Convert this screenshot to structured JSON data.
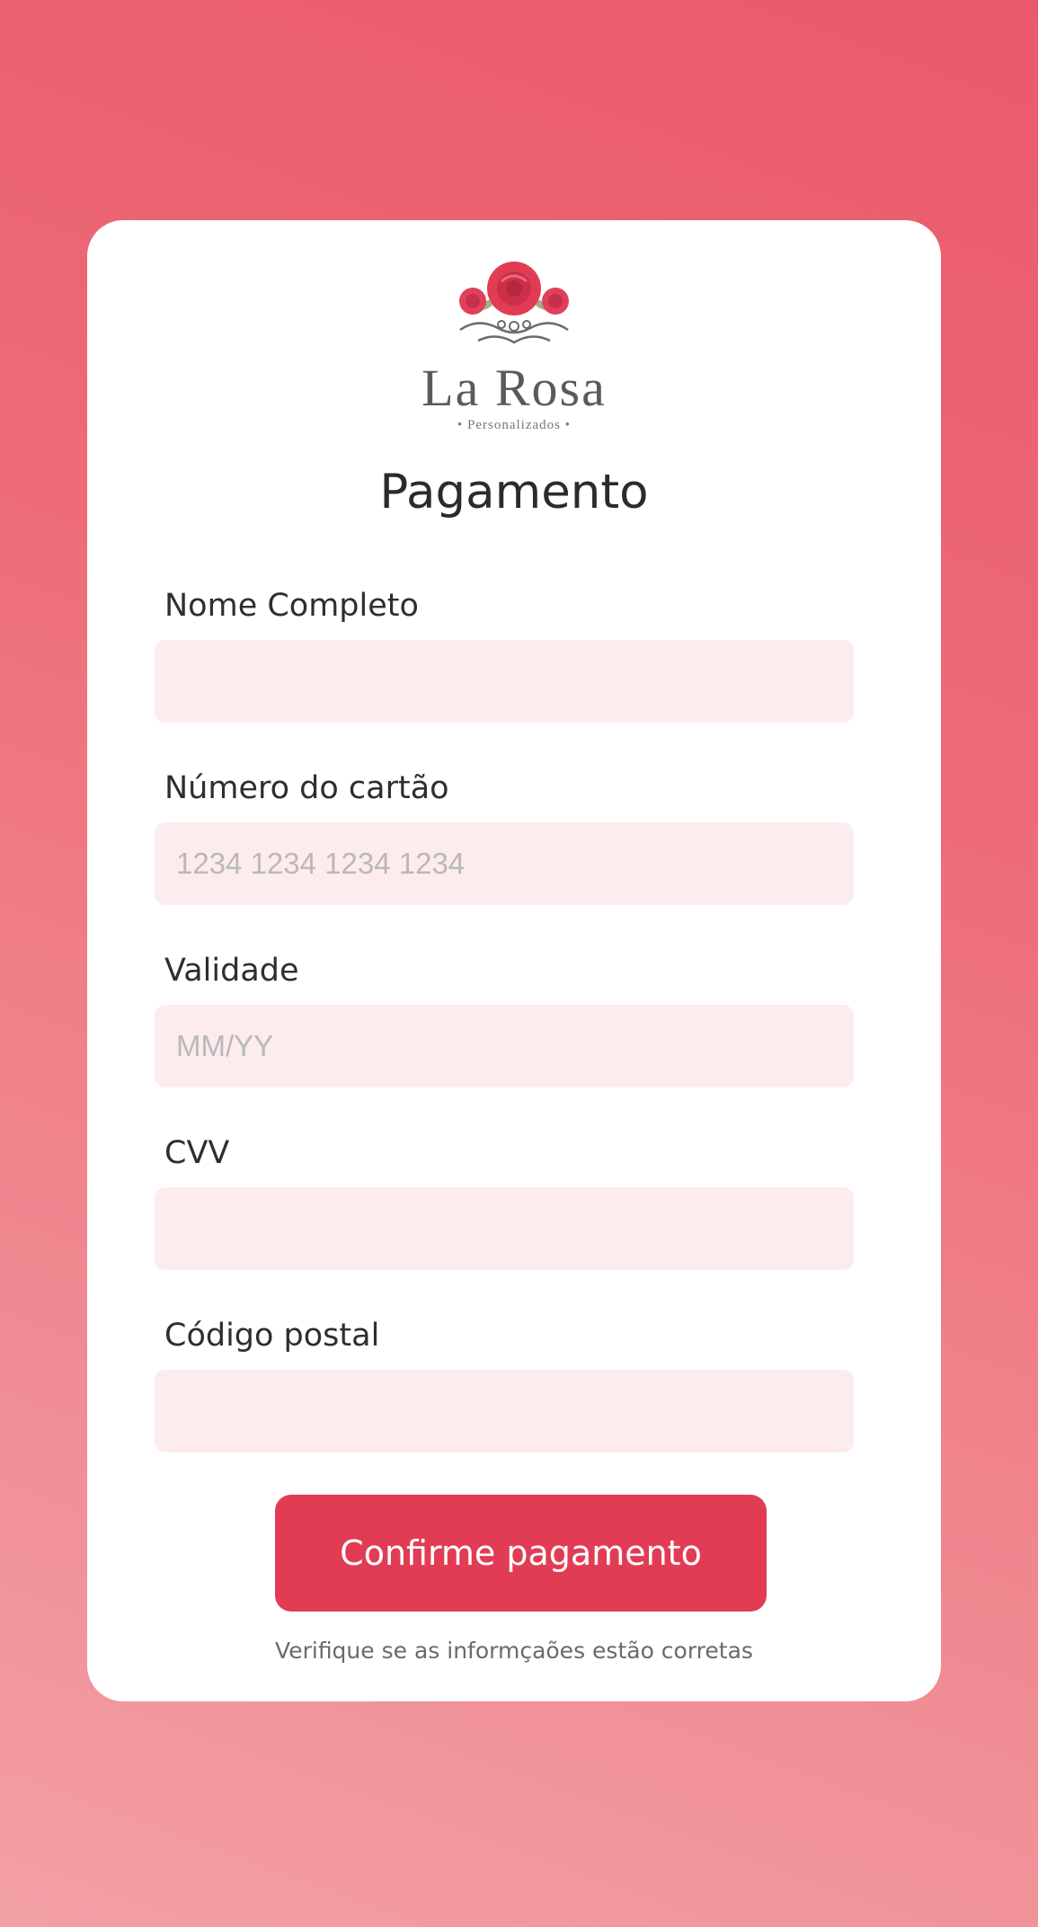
{
  "brand": {
    "name": "La Rosa",
    "subtitle": "• Personalizados •",
    "logo_icon": "rose-icon",
    "accent_color": "#e23c55"
  },
  "page": {
    "title": "Pagamento"
  },
  "form": {
    "fields": [
      {
        "label": "Nome Completo",
        "value": "",
        "placeholder": ""
      },
      {
        "label": "Número do cartão",
        "value": "",
        "placeholder": "1234 1234 1234 1234"
      },
      {
        "label": "Validade",
        "value": "",
        "placeholder": "MM/YY"
      },
      {
        "label": "CVV",
        "value": "",
        "placeholder": ""
      },
      {
        "label": "Código postal",
        "value": "",
        "placeholder": ""
      }
    ],
    "submit_label": "Confirme pagamento",
    "note": "Verifique se as informçaões estão corretas"
  }
}
